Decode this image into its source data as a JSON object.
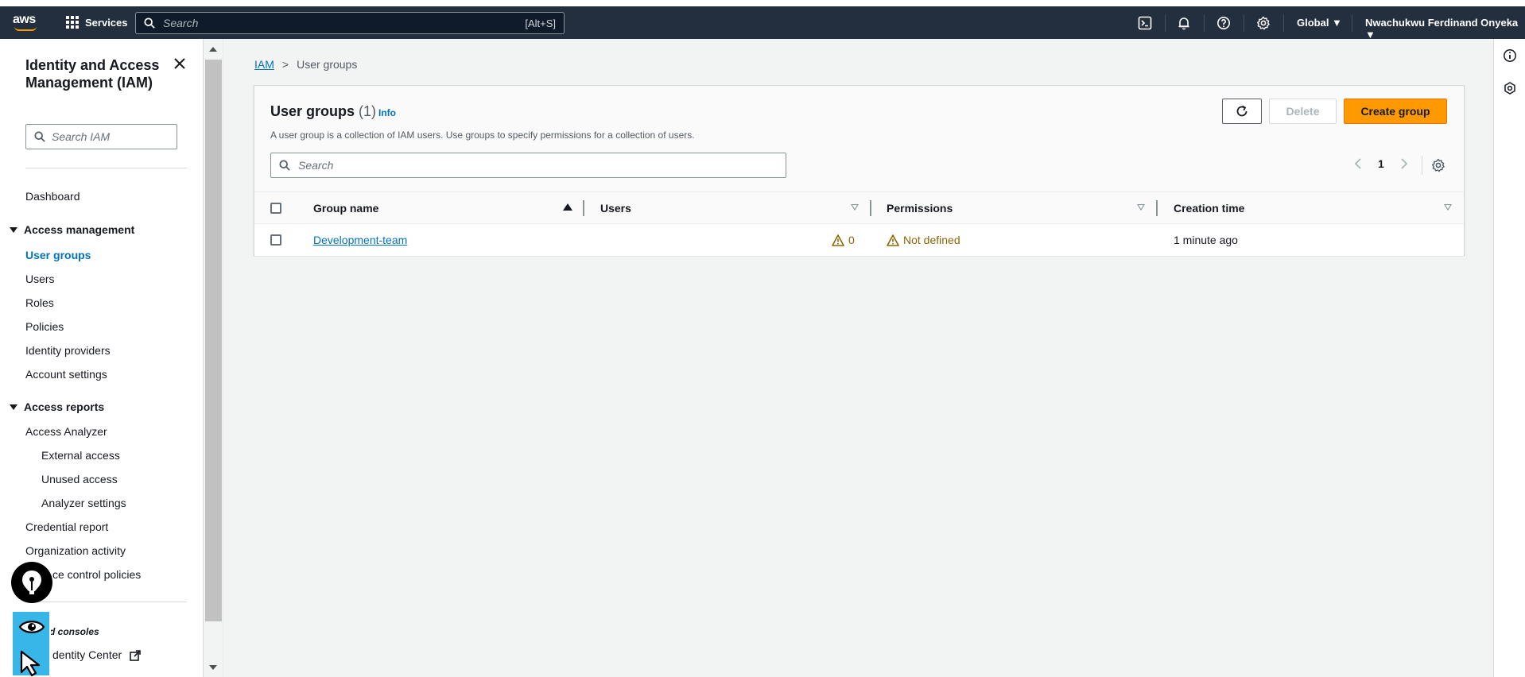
{
  "topbar": {
    "services_label": "Services",
    "search_placeholder": "Search",
    "search_shortcut": "[Alt+S]",
    "region_label": "Global ▼",
    "account_label": "Nwachukwu Ferdinand Onyeka ▼"
  },
  "leftnav": {
    "title": "Identity and Access Management (IAM)",
    "search_placeholder": "Search IAM",
    "dashboard": "Dashboard",
    "access_management": "Access management",
    "items": [
      "User groups",
      "Users",
      "Roles",
      "Policies",
      "Identity providers",
      "Account settings"
    ],
    "access_reports": "Access reports",
    "report_items": [
      "Access Analyzer",
      "External access",
      "Unused access",
      "Analyzer settings",
      "Credential report",
      "Organization activity",
      "ce control policies"
    ],
    "related_label": "d consoles",
    "related_items": [
      "dentity Center"
    ]
  },
  "breadcrumb": {
    "root": "IAM",
    "separator": ">",
    "current": "User groups"
  },
  "panel": {
    "title": "User groups",
    "count": "(1)",
    "info": "Info",
    "description": "A user group is a collection of IAM users. Use groups to specify permissions for a collection of users.",
    "delete_label": "Delete",
    "create_label": "Create group",
    "search_placeholder": "Search",
    "page": "1"
  },
  "table": {
    "columns": [
      "Group name",
      "Users",
      "Permissions",
      "Creation time"
    ],
    "rows": [
      {
        "group_name": "Development-team",
        "users": "0",
        "permissions": "Not defined",
        "creation_time": "1 minute ago"
      }
    ]
  },
  "colors": {
    "topbar_bg": "#232f3e",
    "accent": "#ff9900",
    "link": "#0073bb",
    "warning": "#8d6605"
  }
}
